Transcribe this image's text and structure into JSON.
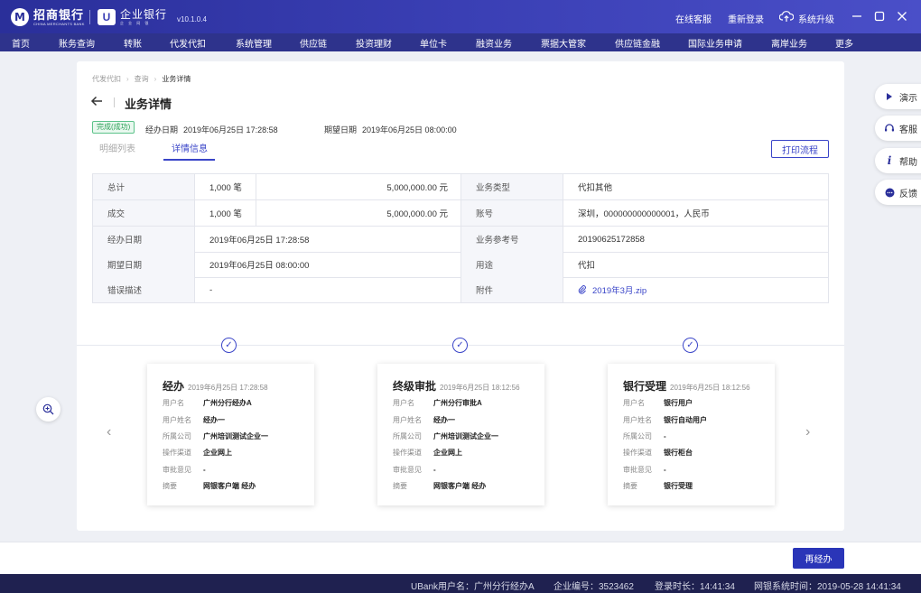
{
  "app": {
    "bank_name": "招商银行",
    "bank_name_en": "CHINA MERCHANTS BANK",
    "product_name": "企业银行",
    "product_name_en": "企 业 网 银",
    "version": "v10.1.0.4",
    "top_links": [
      "在线客服",
      "重新登录",
      "系统升级"
    ]
  },
  "menu": [
    "首页",
    "账务查询",
    "转账",
    "代发代扣",
    "系统管理",
    "供应链",
    "投资理财",
    "单位卡",
    "融资业务",
    "票据大管家",
    "供应链金融",
    "国际业务申请",
    "离岸业务",
    "更多"
  ],
  "breadcrumb": [
    "代发代扣",
    "查询",
    "业务详情"
  ],
  "page": {
    "title": "业务详情",
    "status": "完成(成功)",
    "handle_date_label": "经办日期",
    "handle_date": "2019年06月25日 17:28:58",
    "expect_date_label": "期望日期",
    "expect_date": "2019年06月25日 08:00:00",
    "tabs": [
      "明细列表",
      "详情信息"
    ],
    "active_tab": 1,
    "print_label": "打印流程"
  },
  "detail": {
    "total_label": "总计",
    "total_count": "1,000 笔",
    "total_amount": "5,000,000.00 元",
    "type_label": "业务类型",
    "type_value": "代扣其他",
    "done_label": "成交",
    "done_count": "1,000 笔",
    "done_amount": "5,000,000.00 元",
    "account_label": "账号",
    "account_value": "深圳，000000000000001，人民币",
    "handle_label": "经办日期",
    "handle_value": "2019年06月25日 17:28:58",
    "ref_label": "业务参考号",
    "ref_value": "20190625172858",
    "expect_label": "期望日期",
    "expect_value": "2019年06月25日 08:00:00",
    "purpose_label": "用途",
    "purpose_value": "代扣",
    "error_label": "错误描述",
    "error_value": "-",
    "attach_label": "附件",
    "attach_value": "2019年3月.zip"
  },
  "steps": [
    {
      "title": "经办",
      "time": "2019年6月25日 17:28:58",
      "rows": [
        {
          "k": "用户名",
          "v": "广州分行经办A"
        },
        {
          "k": "用户姓名",
          "v": "经办一"
        },
        {
          "k": "所属公司",
          "v": "广州培训测试企业一"
        },
        {
          "k": "操作渠道",
          "v": "企业网上"
        },
        {
          "k": "审批意见",
          "v": "-"
        },
        {
          "k": "摘要",
          "v": "网银客户端 经办"
        }
      ]
    },
    {
      "title": "终级审批",
      "time": "2019年6月25日 18:12:56",
      "rows": [
        {
          "k": "用户名",
          "v": "广州分行审批A"
        },
        {
          "k": "用户姓名",
          "v": "经办一"
        },
        {
          "k": "所属公司",
          "v": "广州培训测试企业一"
        },
        {
          "k": "操作渠道",
          "v": "企业网上"
        },
        {
          "k": "审批意见",
          "v": "-"
        },
        {
          "k": "摘要",
          "v": "网银客户端 经办"
        }
      ]
    },
    {
      "title": "银行受理",
      "time": "2019年6月25日 18:12:56",
      "rows": [
        {
          "k": "用户名",
          "v": "银行用户"
        },
        {
          "k": "用户姓名",
          "v": "银行自动用户"
        },
        {
          "k": "所属公司",
          "v": "-"
        },
        {
          "k": "操作渠道",
          "v": "银行柜台"
        },
        {
          "k": "审批意见",
          "v": "-"
        },
        {
          "k": "摘要",
          "v": "银行受理"
        }
      ]
    }
  ],
  "side_tools": [
    "演示",
    "客服",
    "帮助",
    "反馈"
  ],
  "redo_label": "再经办",
  "status_bar": {
    "user": "UBank用户名：广州分行经办A",
    "company": "企业编号：3523462",
    "login_time": "登录时长：14:41:34",
    "system_time": "网银系统时间：2019-05-28  14:41:34"
  },
  "colors": {
    "brand": "#2a2f9a",
    "accent": "#3a45c8",
    "success": "#2fa35a"
  }
}
